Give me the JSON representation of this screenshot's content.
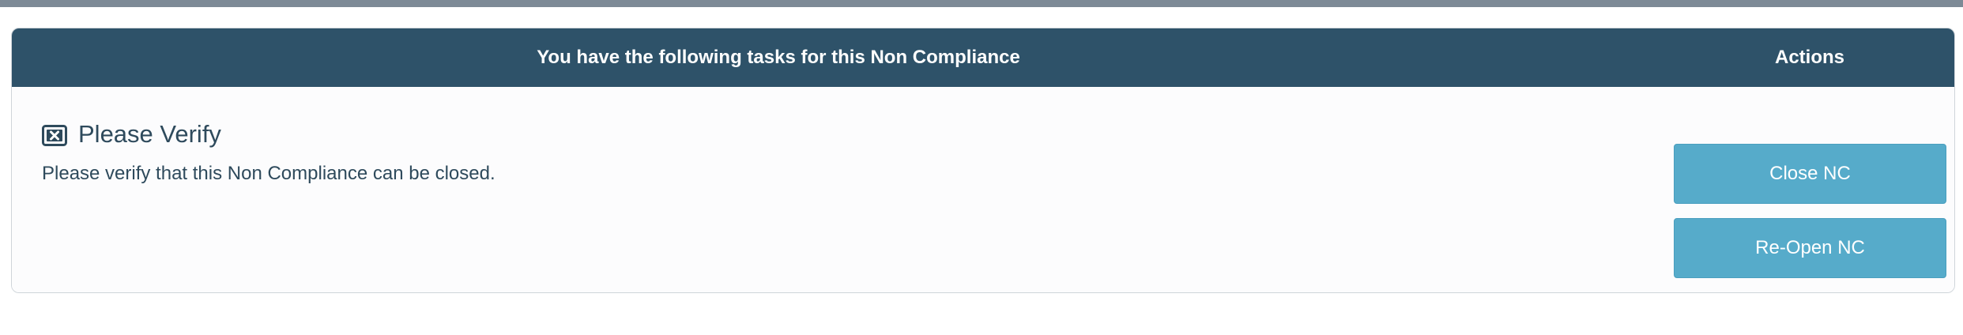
{
  "task_panel": {
    "header_title": "You have the following tasks for this Non Compliance",
    "actions_label": "Actions",
    "task": {
      "icon": "close-box-icon",
      "title": "Please Verify",
      "description": "Please verify that this Non Compliance can be closed."
    },
    "buttons": {
      "close_label": "Close NC",
      "reopen_label": "Re-Open NC"
    }
  },
  "colors": {
    "header_bg": "#2e5269",
    "button_bg": "#56abca",
    "top_bar": "#7d8a96",
    "text": "#2e4a5c"
  }
}
